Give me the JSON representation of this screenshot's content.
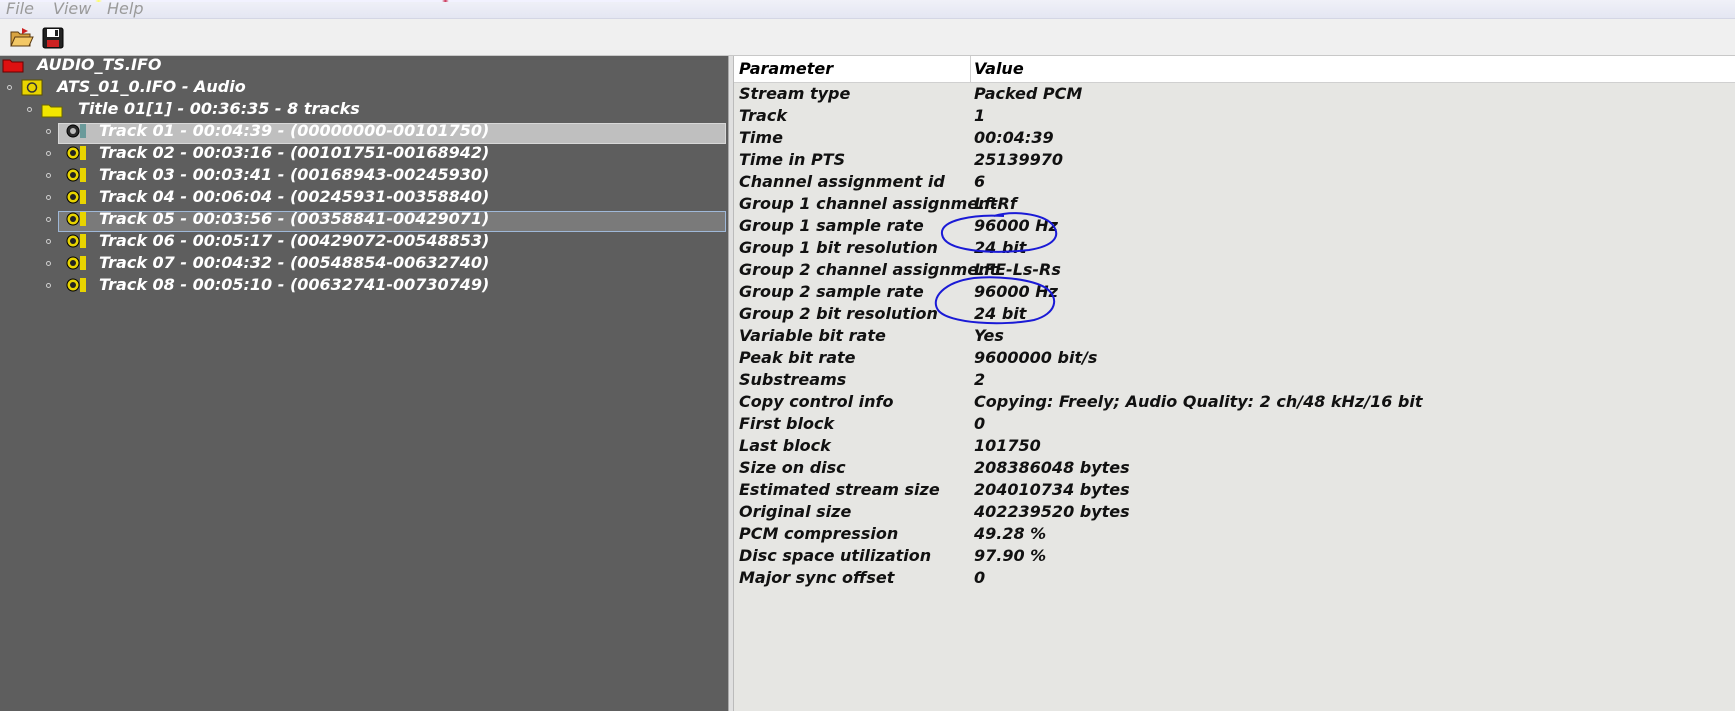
{
  "menu": [
    "File",
    "View",
    "Help"
  ],
  "toolbar": {
    "open_icon": "open-folder-icon",
    "save_icon": "floppy-disk-icon"
  },
  "tree": {
    "root": "AUDIO_TS.IFO",
    "ats": "ATS_01_0.IFO - Audio",
    "title": "Title 01[1] - 00:36:35 - 8 tracks",
    "tracks": [
      "Track 01 - 00:04:39 - (00000000-00101750)",
      "Track 02 - 00:03:16 - (00101751-00168942)",
      "Track 03 - 00:03:41 - (00168943-00245930)",
      "Track 04 - 00:06:04 - (00245931-00358840)",
      "Track 05 - 00:03:56 - (00358841-00429071)",
      "Track 06 - 00:05:17 - (00429072-00548853)",
      "Track 07 - 00:04:32 - (00548854-00632740)",
      "Track 08 - 00:05:10 - (00632741-00730749)"
    ]
  },
  "props": {
    "header": {
      "param": "Parameter",
      "value": "Value"
    },
    "rows": [
      {
        "k": "Stream type",
        "v": "Packed PCM"
      },
      {
        "k": "Track",
        "v": "1"
      },
      {
        "k": "Time",
        "v": "00:04:39"
      },
      {
        "k": "Time in PTS",
        "v": "25139970"
      },
      {
        "k": "Channel assignment id",
        "v": "6"
      },
      {
        "k": "Group 1 channel assignment",
        "v": "Lf-Rf"
      },
      {
        "k": "Group 1 sample rate",
        "v": "96000 Hz"
      },
      {
        "k": "Group 1 bit resolution",
        "v": "24 bit"
      },
      {
        "k": "Group 2 channel assignment",
        "v": "LFE-Ls-Rs"
      },
      {
        "k": "Group 2 sample rate",
        "v": "96000 Hz"
      },
      {
        "k": "Group 2 bit resolution",
        "v": "24 bit"
      },
      {
        "k": "Variable bit rate",
        "v": "Yes"
      },
      {
        "k": "Peak bit rate",
        "v": "9600000 bit/s"
      },
      {
        "k": "Substreams",
        "v": "2"
      },
      {
        "k": "Copy control info",
        "v": "Copying: Freely; Audio Quality: 2 ch/48 kHz/16 bit"
      },
      {
        "k": "First block",
        "v": "0"
      },
      {
        "k": "Last block",
        "v": "101750"
      },
      {
        "k": "Size on disc",
        "v": "208386048 bytes"
      },
      {
        "k": "Estimated stream size",
        "v": "204010734 bytes"
      },
      {
        "k": "Original size",
        "v": "402239520 bytes"
      },
      {
        "k": "PCM compression",
        "v": "49.28 %"
      },
      {
        "k": "Disc space utilization",
        "v": "97.90 %"
      },
      {
        "k": "Major sync offset",
        "v": "0"
      }
    ]
  },
  "colors": {
    "tree_bg": "#5e5e5e",
    "props_bg": "#e6e6e3",
    "annotation": "#1a1ad6"
  }
}
